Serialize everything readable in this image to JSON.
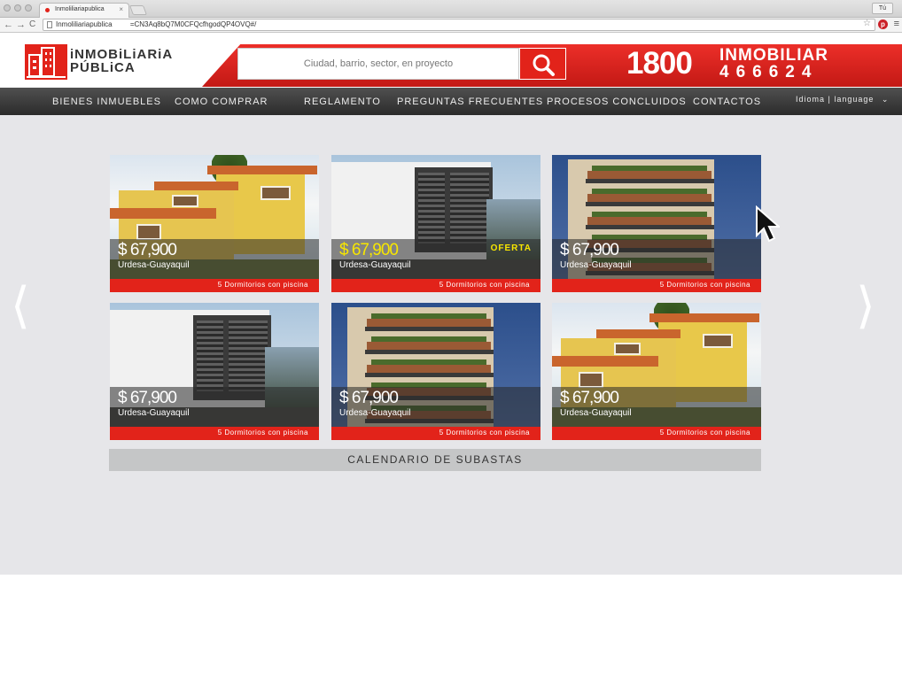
{
  "browser": {
    "tab_title": "Inmoliliariapublica",
    "tab_close": "×",
    "url_prefix": "Inmoliliariapublica",
    "url_rest": "=CN3Aq8bQ7M0CFQcfhgodQP4OVQ#/",
    "profile_label": "Tú",
    "back_glyph": "←",
    "forward_glyph": "→",
    "reload_glyph": "C",
    "star_glyph": "☆",
    "pinterest_glyph": "p",
    "menu_glyph": "≡"
  },
  "header": {
    "logo_line1": "iNMOBiLiARiA",
    "logo_line2": "PÚBLiCA",
    "search_placeholder": "Ciudad, barrio, sector, en proyecto",
    "phone_prefix": "1800",
    "phone_word": "INMOBILIAR",
    "phone_digits": "466624"
  },
  "nav": {
    "items": [
      "BIENES INMUEBLES",
      "COMO COMPRAR",
      "REGLAMENTO",
      "PREGUNTAS FRECUENTES",
      "PROCESOS CONCLUIDOS",
      "CONTACTOS"
    ],
    "language_label": "Idioma | language",
    "language_chevron": "⌄"
  },
  "carousel": {
    "prev_glyph": "⟨",
    "next_glyph": "⟩"
  },
  "listings": [
    {
      "price": "$ 67,900",
      "location": "Urdesa-Guayaquil",
      "feature": "5 Dormitorios con piscina",
      "image": "house"
    },
    {
      "price": "$ 67,900",
      "location": "Urdesa-Guayaquil",
      "feature": "5 Dormitorios con piscina",
      "image": "modern",
      "badge": "OFERTA",
      "highlight": true
    },
    {
      "price": "$ 67,900",
      "location": "Urdesa-Guayaquil",
      "feature": "5 Dormitorios con piscina",
      "image": "tower"
    },
    {
      "price": "$ 67,900",
      "location": "Urdesa-Guayaquil",
      "feature": "5 Dormitorios con piscina",
      "image": "modern"
    },
    {
      "price": "$ 67,900",
      "location": "Urdesa-Guayaquil",
      "feature": "5 Dormitorios con piscina",
      "image": "tower"
    },
    {
      "price": "$ 67,900",
      "location": "Urdesa-Guayaquil",
      "feature": "5 Dormitorios con piscina",
      "image": "house"
    }
  ],
  "calendar_label": "CALENDARIO DE SUBASTAS",
  "colors": {
    "brand_red": "#e2231a",
    "nav_dark": "#3a3a3a",
    "content_bg": "#e6e6e9",
    "highlight_yellow": "#f7e600"
  }
}
